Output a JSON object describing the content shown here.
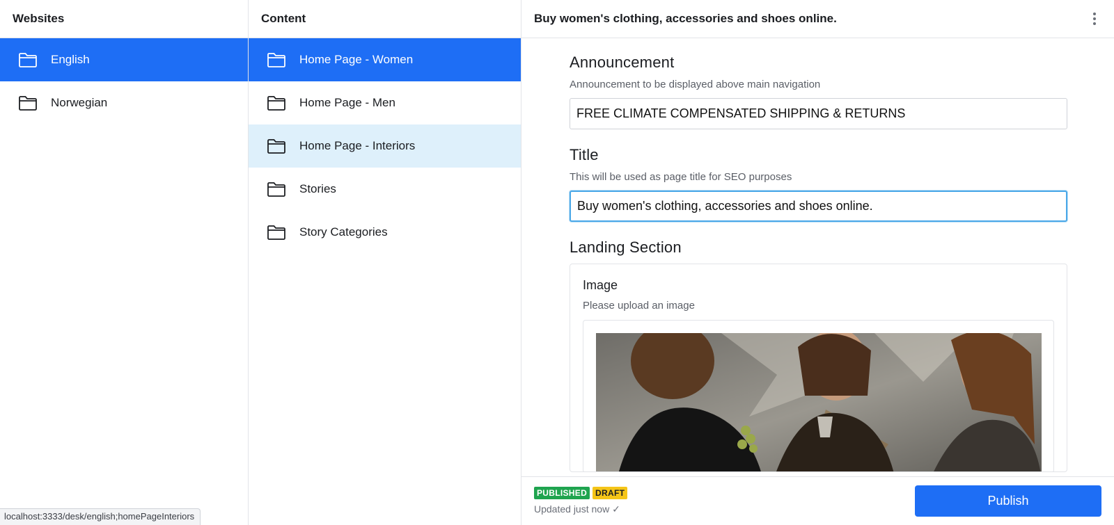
{
  "websites": {
    "header": "Websites",
    "items": [
      {
        "label": "English",
        "icon": "folder-icon",
        "state": "selected"
      },
      {
        "label": "Norwegian",
        "icon": "folder-icon",
        "state": "normal"
      }
    ]
  },
  "content": {
    "header": "Content",
    "items": [
      {
        "label": "Home Page - Women",
        "icon": "folder-icon",
        "state": "selected"
      },
      {
        "label": "Home Page - Men",
        "icon": "folder-icon",
        "state": "normal"
      },
      {
        "label": "Home Page - Interiors",
        "icon": "folder-icon",
        "state": "hover"
      },
      {
        "label": "Stories",
        "icon": "folder-icon",
        "state": "normal"
      },
      {
        "label": "Story Categories",
        "icon": "folder-icon",
        "state": "normal"
      }
    ]
  },
  "editor": {
    "title": "Buy women's clothing, accessories and shoes online.",
    "menu_icon": "vertical-dots-icon",
    "fields": {
      "announcement": {
        "label": "Announcement",
        "description": "Announcement to be displayed above main navigation",
        "value": "FREE CLIMATE COMPENSATED SHIPPING & RETURNS"
      },
      "title": {
        "label": "Title",
        "description": "This will be used as page title for SEO purposes",
        "value": "Buy women's clothing, accessories and shoes online."
      },
      "landing_section": {
        "label": "Landing Section",
        "image": {
          "label": "Image",
          "description": "Please upload an image"
        }
      }
    },
    "footer": {
      "badge_published": "PUBLISHED",
      "badge_draft": "DRAFT",
      "updated": "Updated just now ✓",
      "publish_label": "Publish"
    }
  },
  "status_bar": {
    "url": "localhost:3333/desk/english;homePageInteriors"
  },
  "colors": {
    "accent": "#1e6ef5",
    "hover": "#def0fb",
    "published": "#1fa44f",
    "draft": "#f5c518"
  }
}
